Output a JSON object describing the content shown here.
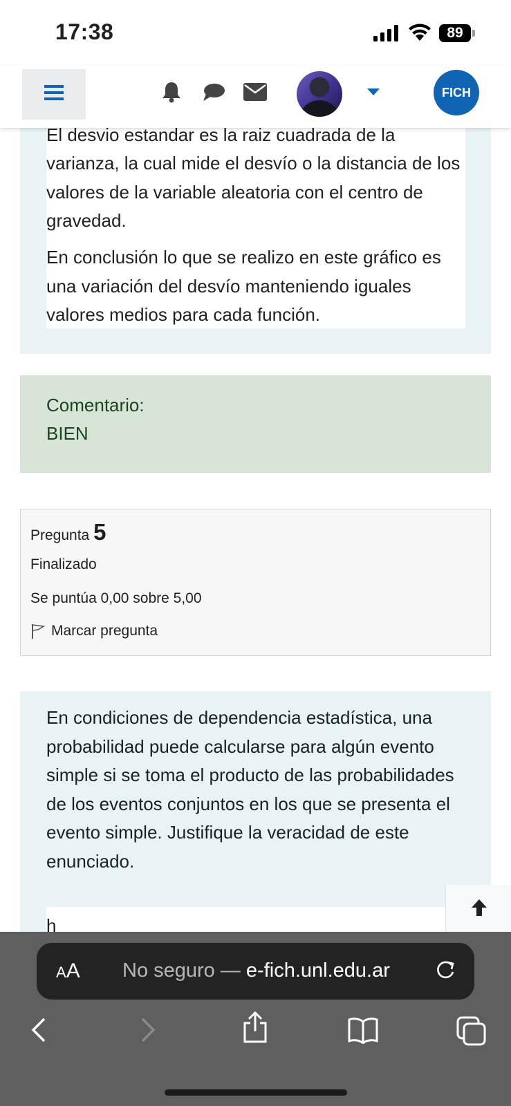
{
  "status_bar": {
    "time": "17:38",
    "battery": "89"
  },
  "navbar": {
    "brand_badge": "FICH"
  },
  "previous_answer": {
    "partial_line": "El desvio estandar es la raiz cuadrada de la",
    "paragraph1_rest": "varianza, la cual mide el desvío o la distancia de los valores de la variable aleatoria con el centro de gravedad.",
    "paragraph2": "En conclusión lo que se realizo en este gráfico es una variación del desvío manteniendo iguales valores medios para cada función."
  },
  "comment": {
    "label": "Comentario:",
    "value": "BIEN"
  },
  "question_info": {
    "label": "Pregunta",
    "number": "5",
    "state": "Finalizado",
    "grade": "Se puntúa 0,00 sobre 5,00",
    "flag_label": "Marcar pregunta"
  },
  "question": {
    "text": "En condiciones de dependencia estadística, una probabilidad puede calcularse para algún evento simple si se toma el producto de las probabilidades de los eventos conjuntos en los que se presenta el evento simple. Justifique la veracidad de este enunciado.",
    "answer_start": "h"
  },
  "browser": {
    "text_size_big": "A",
    "text_size_small": "A",
    "security": "No seguro —",
    "domain": "e-fich.unl.edu.ar"
  },
  "colors": {
    "accent": "#1164b4",
    "content_bg": "#e7f3f5",
    "comment_bg": "#d7e5d6",
    "comment_text": "#1c4220",
    "browser_bar": "#5f5f5f"
  },
  "icons": [
    "menu-icon",
    "bell-icon",
    "chat-icon",
    "mail-icon",
    "caret-down-icon",
    "flag-icon",
    "arrow-up-icon",
    "reload-icon",
    "back-icon",
    "forward-icon",
    "share-icon",
    "bookmarks-icon",
    "tabs-icon"
  ]
}
